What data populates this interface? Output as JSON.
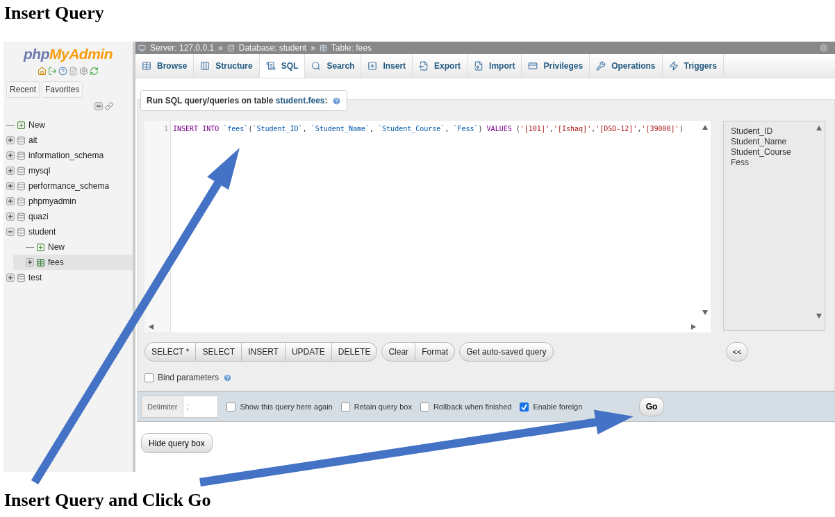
{
  "heading": "Insert Query",
  "sidebar": {
    "logo": [
      "php",
      "MyAdmin"
    ],
    "tabs": [
      {
        "label": "Recent"
      },
      {
        "label": "Favorites"
      }
    ],
    "tree": [
      {
        "label": "New",
        "kind": "new",
        "selected": false
      },
      {
        "label": "ait",
        "kind": "db",
        "expanded": false,
        "selected": false
      },
      {
        "label": "information_schema",
        "kind": "db",
        "expanded": false,
        "selected": false
      },
      {
        "label": "mysql",
        "kind": "db",
        "expanded": false,
        "selected": false
      },
      {
        "label": "performance_schema",
        "kind": "db",
        "expanded": false,
        "selected": false
      },
      {
        "label": "phpmyadmin",
        "kind": "db",
        "expanded": false,
        "selected": false
      },
      {
        "label": "quazi",
        "kind": "db",
        "expanded": false,
        "selected": false
      },
      {
        "label": "student",
        "kind": "db",
        "expanded": true,
        "selected": false,
        "children": [
          {
            "label": "New",
            "kind": "new",
            "selected": false
          },
          {
            "label": "fees",
            "kind": "table",
            "expanded": false,
            "selected": true
          }
        ]
      },
      {
        "label": "test",
        "kind": "db",
        "expanded": false,
        "selected": false
      }
    ]
  },
  "breadcrumb": [
    {
      "label": "Server: 127.0.0.1"
    },
    {
      "label": "Database: student"
    },
    {
      "label": "Table: fees"
    }
  ],
  "breadcrumb_separator": "»",
  "tabs": [
    {
      "label": "Browse",
      "selected": false
    },
    {
      "label": "Structure",
      "selected": false
    },
    {
      "label": "SQL",
      "selected": true
    },
    {
      "label": "Search",
      "selected": false
    },
    {
      "label": "Insert",
      "selected": false
    },
    {
      "label": "Export",
      "selected": false
    },
    {
      "label": "Import",
      "selected": false
    },
    {
      "label": "Privileges",
      "selected": false
    },
    {
      "label": "Operations",
      "selected": false
    },
    {
      "label": "Triggers",
      "selected": false
    }
  ],
  "query_panel": {
    "legend": "Run SQL query/queries on table **student.fees**:",
    "line_number": "1",
    "tokens": [
      {
        "kind": "keyword",
        "text": "INSERT INTO "
      },
      {
        "kind": "ident",
        "text": "`fees`"
      },
      {
        "kind": "punct",
        "text": "("
      },
      {
        "kind": "ident",
        "text": "`Student_ID`"
      },
      {
        "kind": "punct",
        "text": ", "
      },
      {
        "kind": "ident",
        "text": "`Student_Name`"
      },
      {
        "kind": "punct",
        "text": ", "
      },
      {
        "kind": "ident",
        "text": "`Student_Course`"
      },
      {
        "kind": "punct",
        "text": ", "
      },
      {
        "kind": "ident",
        "text": "`Fess`"
      },
      {
        "kind": "punct",
        "text": ") "
      },
      {
        "kind": "keyword",
        "text": "VALUES "
      },
      {
        "kind": "punct",
        "text": "("
      },
      {
        "kind": "string",
        "text": "'[101]'"
      },
      {
        "kind": "punct",
        "text": ","
      },
      {
        "kind": "string",
        "text": "'[Ishaq]'"
      },
      {
        "kind": "punct",
        "text": ","
      },
      {
        "kind": "string",
        "text": "'[DSD-12]'"
      },
      {
        "kind": "punct",
        "text": ","
      },
      {
        "kind": "string",
        "text": "'[39000]'"
      },
      {
        "kind": "punct",
        "text": ")"
      }
    ],
    "columns": [
      "Student_ID",
      "Student_Name",
      "Student_Course",
      "Fess"
    ],
    "insert_column_button": "<<",
    "button_groups": [
      [
        "SELECT *",
        "SELECT",
        "INSERT",
        "UPDATE",
        "DELETE"
      ],
      [
        "Clear",
        "Format"
      ],
      [
        "Get auto-saved query"
      ]
    ],
    "bind_parameters": {
      "label": "Bind parameters",
      "checked": false
    }
  },
  "footer": {
    "delimiter_label": "Delimiter",
    "delimiter_value": ";",
    "options": [
      {
        "label": "Show this query here again",
        "checked": false
      },
      {
        "label": "Retain query box",
        "checked": false
      },
      {
        "label": "Rollback when finished",
        "checked": false
      },
      {
        "label": "Enable foreign",
        "checked": true
      }
    ],
    "go": "Go"
  },
  "hide_button": "Hide query box",
  "caption": "Insert Query and Click Go"
}
